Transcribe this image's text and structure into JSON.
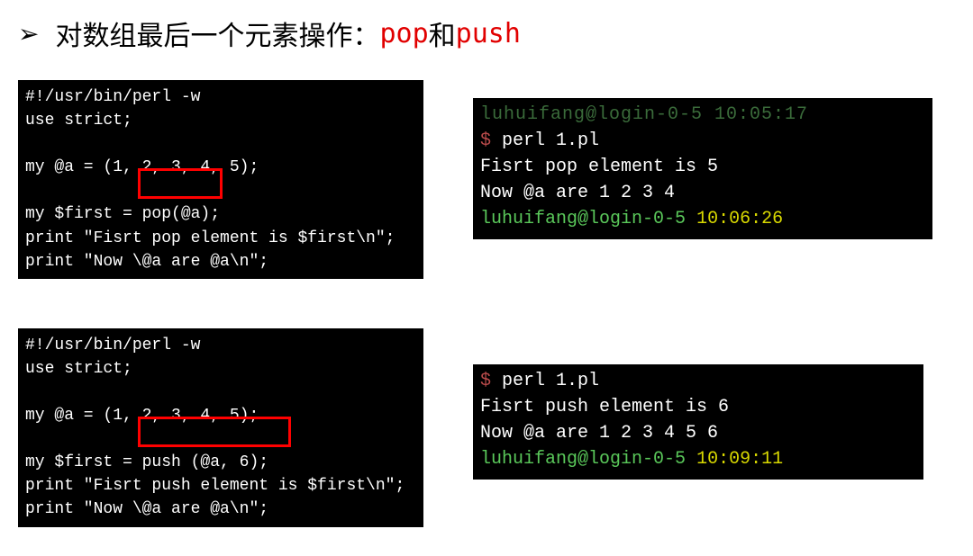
{
  "title": {
    "bullet": "➢",
    "black": "对数组最后一个元素操作：",
    "red1": "pop",
    "sep": "和",
    "red2": "push"
  },
  "example1": {
    "code": "#!/usr/bin/perl -w\nuse strict;\n\nmy @a = (1, 2, 3, 4, 5);\n\nmy $first = pop(@a);\nprint \"Fisrt pop element is $first\\n\";\nprint \"Now \\@a are @a\\n\";",
    "out_topline": "luhuifang@login-0-5 10:05:17",
    "out_cmd": "perl 1.pl",
    "out_line1": "Fisrt pop element is 5",
    "out_line2": "Now @a are 1 2 3 4",
    "out_user": "luhuifang@login-0-5",
    "out_time": "10:06:26"
  },
  "example2": {
    "code": "#!/usr/bin/perl -w\nuse strict;\n\nmy @a = (1, 2, 3, 4, 5);\n\nmy $first = push (@a, 6);\nprint \"Fisrt push element is $first\\n\";\nprint \"Now \\@a are @a\\n\";",
    "out_cmd": "perl 1.pl",
    "out_line1": "Fisrt push element is 6",
    "out_line2": "Now @a are 1 2 3 4 5 6",
    "out_user": "luhuifang@login-0-5",
    "out_time": "10:09:11"
  }
}
